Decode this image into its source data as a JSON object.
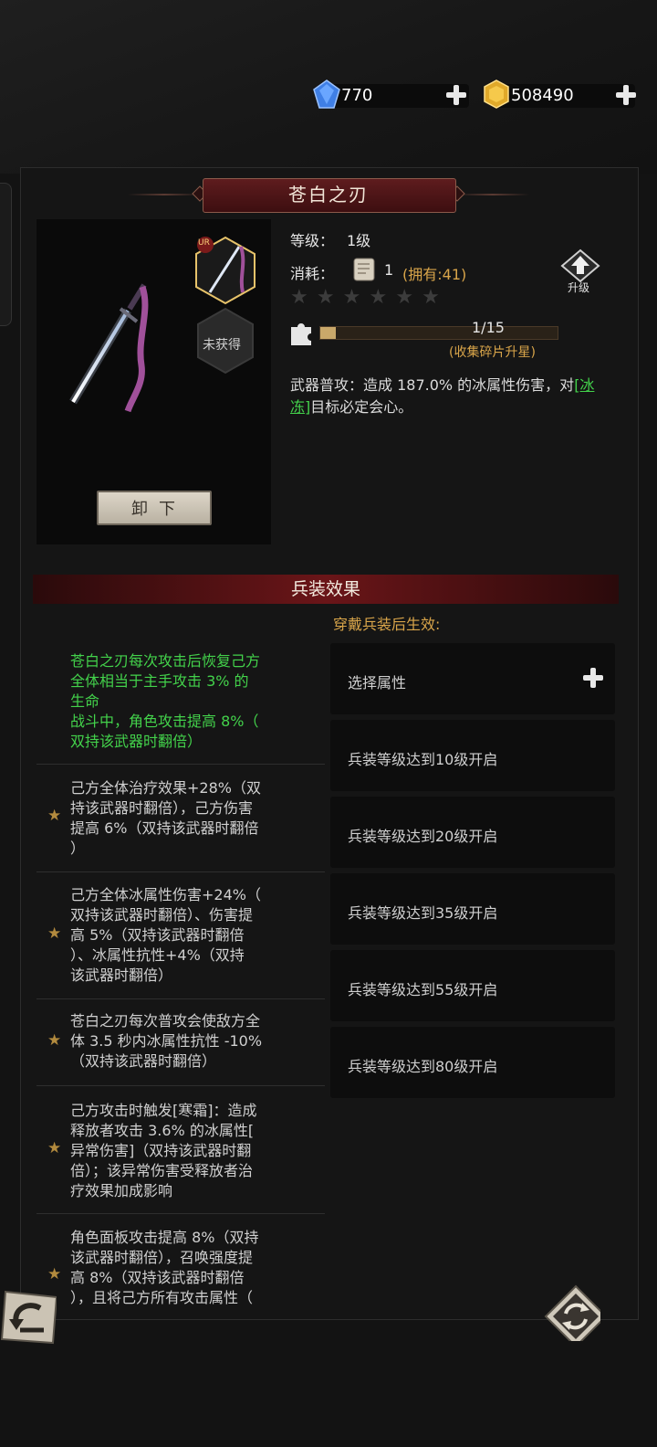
{
  "currency": {
    "gems": "770",
    "gold": "508490"
  },
  "weapon": {
    "name": "苍白之刃",
    "rarity": "UR",
    "not_obtained": "未获得",
    "level_label": "等级：",
    "level_value": "1级",
    "cost_label": "消耗：",
    "cost_value": "1",
    "owned": "(拥有:41)",
    "upgrade_label": "升级",
    "stars": 6,
    "fragments": "1/15",
    "fragments_fraction": 0.067,
    "fragments_hint": "(收集碎片升星)",
    "desc_prefix": "武器普攻：造成 187.0% 的冰属性伤害，对",
    "desc_link": "[冰冻]",
    "desc_suffix": "目标必定会心。",
    "unequip_label": "卸下"
  },
  "equip_effects": {
    "title": "兵装效果",
    "note": "穿戴兵装后生效:",
    "active_effect": [
      "苍白之刃每次攻击后恢复己方",
      "全体相当于主手攻击 3% 的",
      "生命",
      "战斗中，角色攻击提高 8%（",
      "双持该武器时翻倍）"
    ],
    "star_effects": [
      [
        "己方全体治疗效果+28%（双",
        "持该武器时翻倍），己方伤害",
        "提高 6%（双持该武器时翻倍",
        "）"
      ],
      [
        "己方全体冰属性伤害+24%（",
        "双持该武器时翻倍）、伤害提",
        "高 5%（双持该武器时翻倍",
        "）、冰属性抗性+4%（双持",
        "该武器时翻倍）"
      ],
      [
        "苍白之刃每次普攻会使敌方全",
        "体 3.5 秒内冰属性抗性 -10%",
        "（双持该武器时翻倍）"
      ],
      [
        "己方攻击时触发[寒霜]：造成",
        "释放者攻击 3.6% 的冰属性[",
        "异常伤害]（双持该武器时翻",
        "倍）；该异常伤害受释放者治",
        "疗效果加成影响"
      ],
      [
        "角色面板攻击提高 8%（双持",
        "该武器时翻倍），召唤强度提",
        "高 8%（双持该武器时翻倍",
        "），且将己方所有攻击属性（"
      ]
    ],
    "slots": [
      "选择属性",
      "兵装等级达到10级开启",
      "兵装等级达到20级开启",
      "兵装等级达到35级开启",
      "兵装等级达到55级开启",
      "兵装等级达到80级开启"
    ]
  },
  "colors": {
    "accent_gold": "#d9a54a",
    "effect_green": "#43d24b",
    "title_red": "#5e1c1e"
  }
}
